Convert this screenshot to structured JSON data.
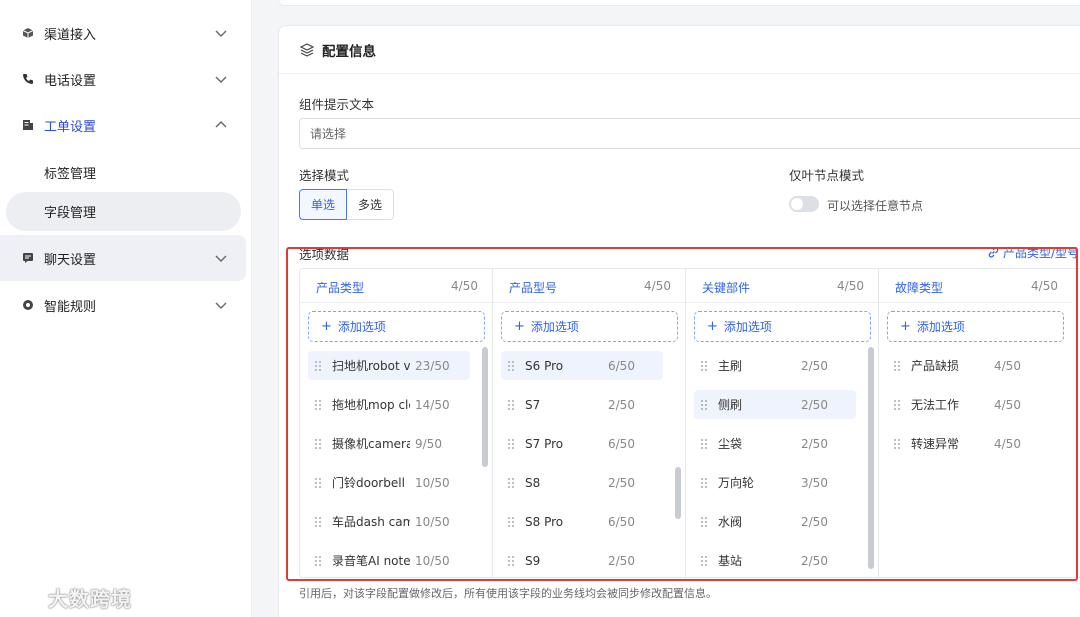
{
  "sidebar": {
    "groups": [
      {
        "label": "渠道接入",
        "icon": "cube-icon"
      },
      {
        "label": "电话设置",
        "icon": "phone-icon"
      },
      {
        "label": "工单设置",
        "icon": "ticket-icon"
      },
      {
        "label": "聊天设置",
        "icon": "chat-icon"
      },
      {
        "label": "智能规则",
        "icon": "rule-icon"
      }
    ],
    "sub_items": [
      {
        "label": "标签管理"
      },
      {
        "label": "字段管理"
      }
    ]
  },
  "card": {
    "title": "配置信息",
    "hint_label": "组件提示文本",
    "hint_placeholder": "请选择",
    "mode_label": "选择模式",
    "mode_options": [
      "单选",
      "多选"
    ],
    "mode_selected": "单选",
    "leaf_label": "仅叶节点模式",
    "leaf_toggle_text": "可以选择任意节点",
    "leaf_toggle_on": false,
    "options_label": "选项数据",
    "link_text": "产品类型/型号",
    "add_label": "添加选项",
    "footnote": "引用后，对该字段配置做修改后，所有使用该字段的业务线均会被同步修改配置信息。",
    "columns": [
      {
        "name": "产品类型",
        "count": "4/50",
        "items": [
          {
            "text": "扫地机robot va",
            "count": "23/50",
            "hl": true
          },
          {
            "text": "拖地机mop cle",
            "count": "14/50"
          },
          {
            "text": "摄像机camera",
            "count": "9/50"
          },
          {
            "text": "门铃doorbell",
            "count": "10/50"
          },
          {
            "text": "车品dash cam",
            "count": "10/50"
          },
          {
            "text": "录音笔AI note",
            "count": "10/50"
          }
        ]
      },
      {
        "name": "产品型号",
        "count": "4/50",
        "items": [
          {
            "text": "S6 Pro",
            "count": "6/50",
            "hl": true
          },
          {
            "text": "S7",
            "count": "2/50"
          },
          {
            "text": "S7 Pro",
            "count": "6/50"
          },
          {
            "text": "S8",
            "count": "2/50"
          },
          {
            "text": "S8 Pro",
            "count": "6/50"
          },
          {
            "text": "S9",
            "count": "2/50"
          }
        ]
      },
      {
        "name": "关键部件",
        "count": "4/50",
        "items": [
          {
            "text": "主刷",
            "count": "2/50"
          },
          {
            "text": "侧刷",
            "count": "2/50",
            "hl": true
          },
          {
            "text": "尘袋",
            "count": "2/50"
          },
          {
            "text": "万向轮",
            "count": "3/50"
          },
          {
            "text": "水阀",
            "count": "2/50"
          },
          {
            "text": "基站",
            "count": "2/50"
          }
        ]
      },
      {
        "name": "故障类型",
        "count": "4/50",
        "items": [
          {
            "text": "产品缺损",
            "count": "4/50"
          },
          {
            "text": "无法工作",
            "count": "4/50"
          },
          {
            "text": "转速异常",
            "count": "4/50"
          }
        ]
      }
    ]
  },
  "watermark": "大数跨境",
  "colors": {
    "accent": "#2f63e8",
    "highlight": "#e03b36"
  }
}
